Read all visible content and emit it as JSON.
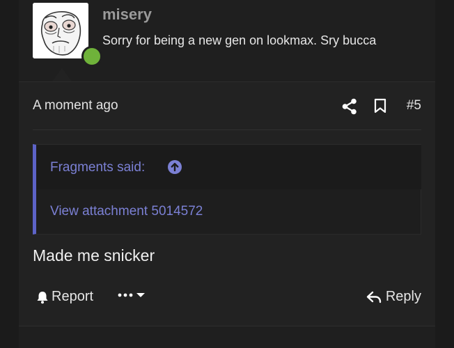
{
  "post": {
    "username": "misery",
    "user_title": "Sorry for being a new gen on lookmax. Sry bucca",
    "timestamp": "A moment ago",
    "post_number": "#5",
    "online_color": "#6fb23a",
    "quote": {
      "author": "Fragments said:",
      "attachment": "View attachment 5014572",
      "accent_color": "#5d63c7"
    },
    "message": "Made me snicker",
    "actions": {
      "report_label": "Report",
      "reply_label": "Reply"
    }
  },
  "icons": {
    "share": "share-icon",
    "bookmark": "bookmark-icon",
    "quote_up": "arrow-up-circle-icon",
    "report": "bell-icon",
    "more": "ellipsis-icon",
    "dropdown": "caret-down-icon",
    "reply": "reply-arrow-icon"
  }
}
